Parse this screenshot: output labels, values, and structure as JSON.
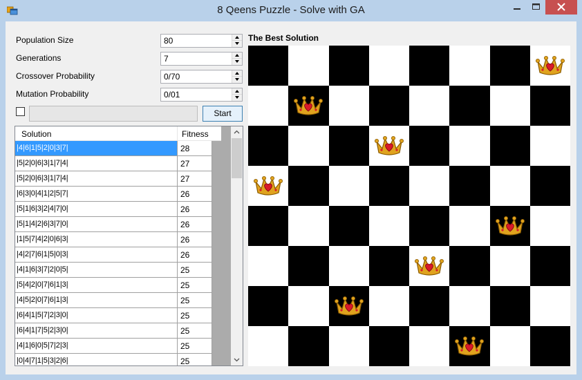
{
  "window": {
    "title": "8 Qeens Puzzle - Solve with GA",
    "icons": {
      "app": "app-window-icon",
      "minimize": "minimize-icon",
      "maximize": "maximize-icon",
      "close": "close-icon"
    }
  },
  "params": [
    {
      "label": "Population Size",
      "value": "80"
    },
    {
      "label": "Generations",
      "value": "7"
    },
    {
      "label": "Crossover Probability",
      "value": "0/70"
    },
    {
      "label": "Mutation Probability",
      "value": "0/01"
    }
  ],
  "controls": {
    "checkbox_checked": false,
    "progress": 0,
    "start_label": "Start"
  },
  "grid": {
    "columns": [
      "Solution",
      "Fitness"
    ],
    "selected_row": 0,
    "rows": [
      {
        "solution": "|4|6|1|5|2|0|3|7|",
        "fitness": "28"
      },
      {
        "solution": "|5|2|0|6|3|1|7|4|",
        "fitness": "27"
      },
      {
        "solution": "|5|2|0|6|3|1|7|4|",
        "fitness": "27"
      },
      {
        "solution": "|6|3|0|4|1|2|5|7|",
        "fitness": "26"
      },
      {
        "solution": "|5|1|6|3|2|4|7|0|",
        "fitness": "26"
      },
      {
        "solution": "|5|1|4|2|6|3|7|0|",
        "fitness": "26"
      },
      {
        "solution": "|1|5|7|4|2|0|6|3|",
        "fitness": "26"
      },
      {
        "solution": "|4|2|7|6|1|5|0|3|",
        "fitness": "26"
      },
      {
        "solution": "|4|1|6|3|7|2|0|5|",
        "fitness": "25"
      },
      {
        "solution": "|5|4|2|0|7|6|1|3|",
        "fitness": "25"
      },
      {
        "solution": "|4|5|2|0|7|6|1|3|",
        "fitness": "25"
      },
      {
        "solution": "|6|4|1|5|7|2|3|0|",
        "fitness": "25"
      },
      {
        "solution": "|6|4|1|7|5|2|3|0|",
        "fitness": "25"
      },
      {
        "solution": "|4|1|6|0|5|7|2|3|",
        "fitness": "25"
      },
      {
        "solution": "|0|4|7|1|5|3|2|6|",
        "fitness": "25"
      }
    ]
  },
  "board": {
    "title": "The Best Solution",
    "size": 8,
    "queen_rows_by_column": [
      3,
      1,
      6,
      2,
      5,
      7,
      4,
      0
    ],
    "piece_icon": "queen-crown-icon",
    "colors": {
      "dark": "#000000",
      "light": "#ffffff",
      "crown_gold": "#e0a31e",
      "heart_red": "#d91a2a"
    }
  }
}
